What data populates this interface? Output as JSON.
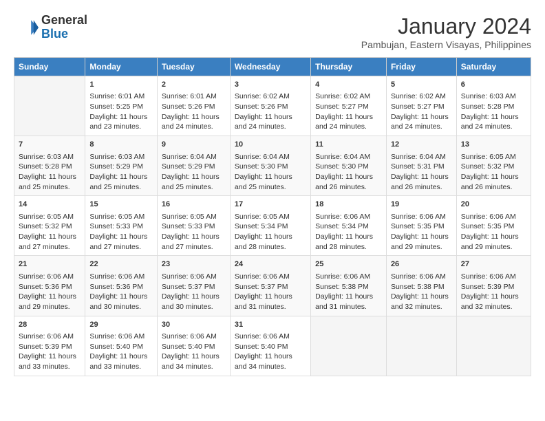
{
  "header": {
    "logo": {
      "line1": "General",
      "line2": "Blue"
    },
    "title": "January 2024",
    "subtitle": "Pambujan, Eastern Visayas, Philippines"
  },
  "weekdays": [
    "Sunday",
    "Monday",
    "Tuesday",
    "Wednesday",
    "Thursday",
    "Friday",
    "Saturday"
  ],
  "weeks": [
    [
      {
        "day": "",
        "sunrise": "",
        "sunset": "",
        "daylight": ""
      },
      {
        "day": "1",
        "sunrise": "Sunrise: 6:01 AM",
        "sunset": "Sunset: 5:25 PM",
        "daylight": "Daylight: 11 hours and 23 minutes."
      },
      {
        "day": "2",
        "sunrise": "Sunrise: 6:01 AM",
        "sunset": "Sunset: 5:26 PM",
        "daylight": "Daylight: 11 hours and 24 minutes."
      },
      {
        "day": "3",
        "sunrise": "Sunrise: 6:02 AM",
        "sunset": "Sunset: 5:26 PM",
        "daylight": "Daylight: 11 hours and 24 minutes."
      },
      {
        "day": "4",
        "sunrise": "Sunrise: 6:02 AM",
        "sunset": "Sunset: 5:27 PM",
        "daylight": "Daylight: 11 hours and 24 minutes."
      },
      {
        "day": "5",
        "sunrise": "Sunrise: 6:02 AM",
        "sunset": "Sunset: 5:27 PM",
        "daylight": "Daylight: 11 hours and 24 minutes."
      },
      {
        "day": "6",
        "sunrise": "Sunrise: 6:03 AM",
        "sunset": "Sunset: 5:28 PM",
        "daylight": "Daylight: 11 hours and 24 minutes."
      }
    ],
    [
      {
        "day": "7",
        "sunrise": "Sunrise: 6:03 AM",
        "sunset": "Sunset: 5:28 PM",
        "daylight": "Daylight: 11 hours and 25 minutes."
      },
      {
        "day": "8",
        "sunrise": "Sunrise: 6:03 AM",
        "sunset": "Sunset: 5:29 PM",
        "daylight": "Daylight: 11 hours and 25 minutes."
      },
      {
        "day": "9",
        "sunrise": "Sunrise: 6:04 AM",
        "sunset": "Sunset: 5:29 PM",
        "daylight": "Daylight: 11 hours and 25 minutes."
      },
      {
        "day": "10",
        "sunrise": "Sunrise: 6:04 AM",
        "sunset": "Sunset: 5:30 PM",
        "daylight": "Daylight: 11 hours and 25 minutes."
      },
      {
        "day": "11",
        "sunrise": "Sunrise: 6:04 AM",
        "sunset": "Sunset: 5:30 PM",
        "daylight": "Daylight: 11 hours and 26 minutes."
      },
      {
        "day": "12",
        "sunrise": "Sunrise: 6:04 AM",
        "sunset": "Sunset: 5:31 PM",
        "daylight": "Daylight: 11 hours and 26 minutes."
      },
      {
        "day": "13",
        "sunrise": "Sunrise: 6:05 AM",
        "sunset": "Sunset: 5:32 PM",
        "daylight": "Daylight: 11 hours and 26 minutes."
      }
    ],
    [
      {
        "day": "14",
        "sunrise": "Sunrise: 6:05 AM",
        "sunset": "Sunset: 5:32 PM",
        "daylight": "Daylight: 11 hours and 27 minutes."
      },
      {
        "day": "15",
        "sunrise": "Sunrise: 6:05 AM",
        "sunset": "Sunset: 5:33 PM",
        "daylight": "Daylight: 11 hours and 27 minutes."
      },
      {
        "day": "16",
        "sunrise": "Sunrise: 6:05 AM",
        "sunset": "Sunset: 5:33 PM",
        "daylight": "Daylight: 11 hours and 27 minutes."
      },
      {
        "day": "17",
        "sunrise": "Sunrise: 6:05 AM",
        "sunset": "Sunset: 5:34 PM",
        "daylight": "Daylight: 11 hours and 28 minutes."
      },
      {
        "day": "18",
        "sunrise": "Sunrise: 6:06 AM",
        "sunset": "Sunset: 5:34 PM",
        "daylight": "Daylight: 11 hours and 28 minutes."
      },
      {
        "day": "19",
        "sunrise": "Sunrise: 6:06 AM",
        "sunset": "Sunset: 5:35 PM",
        "daylight": "Daylight: 11 hours and 29 minutes."
      },
      {
        "day": "20",
        "sunrise": "Sunrise: 6:06 AM",
        "sunset": "Sunset: 5:35 PM",
        "daylight": "Daylight: 11 hours and 29 minutes."
      }
    ],
    [
      {
        "day": "21",
        "sunrise": "Sunrise: 6:06 AM",
        "sunset": "Sunset: 5:36 PM",
        "daylight": "Daylight: 11 hours and 29 minutes."
      },
      {
        "day": "22",
        "sunrise": "Sunrise: 6:06 AM",
        "sunset": "Sunset: 5:36 PM",
        "daylight": "Daylight: 11 hours and 30 minutes."
      },
      {
        "day": "23",
        "sunrise": "Sunrise: 6:06 AM",
        "sunset": "Sunset: 5:37 PM",
        "daylight": "Daylight: 11 hours and 30 minutes."
      },
      {
        "day": "24",
        "sunrise": "Sunrise: 6:06 AM",
        "sunset": "Sunset: 5:37 PM",
        "daylight": "Daylight: 11 hours and 31 minutes."
      },
      {
        "day": "25",
        "sunrise": "Sunrise: 6:06 AM",
        "sunset": "Sunset: 5:38 PM",
        "daylight": "Daylight: 11 hours and 31 minutes."
      },
      {
        "day": "26",
        "sunrise": "Sunrise: 6:06 AM",
        "sunset": "Sunset: 5:38 PM",
        "daylight": "Daylight: 11 hours and 32 minutes."
      },
      {
        "day": "27",
        "sunrise": "Sunrise: 6:06 AM",
        "sunset": "Sunset: 5:39 PM",
        "daylight": "Daylight: 11 hours and 32 minutes."
      }
    ],
    [
      {
        "day": "28",
        "sunrise": "Sunrise: 6:06 AM",
        "sunset": "Sunset: 5:39 PM",
        "daylight": "Daylight: 11 hours and 33 minutes."
      },
      {
        "day": "29",
        "sunrise": "Sunrise: 6:06 AM",
        "sunset": "Sunset: 5:40 PM",
        "daylight": "Daylight: 11 hours and 33 minutes."
      },
      {
        "day": "30",
        "sunrise": "Sunrise: 6:06 AM",
        "sunset": "Sunset: 5:40 PM",
        "daylight": "Daylight: 11 hours and 34 minutes."
      },
      {
        "day": "31",
        "sunrise": "Sunrise: 6:06 AM",
        "sunset": "Sunset: 5:40 PM",
        "daylight": "Daylight: 11 hours and 34 minutes."
      },
      {
        "day": "",
        "sunrise": "",
        "sunset": "",
        "daylight": ""
      },
      {
        "day": "",
        "sunrise": "",
        "sunset": "",
        "daylight": ""
      },
      {
        "day": "",
        "sunrise": "",
        "sunset": "",
        "daylight": ""
      }
    ]
  ]
}
